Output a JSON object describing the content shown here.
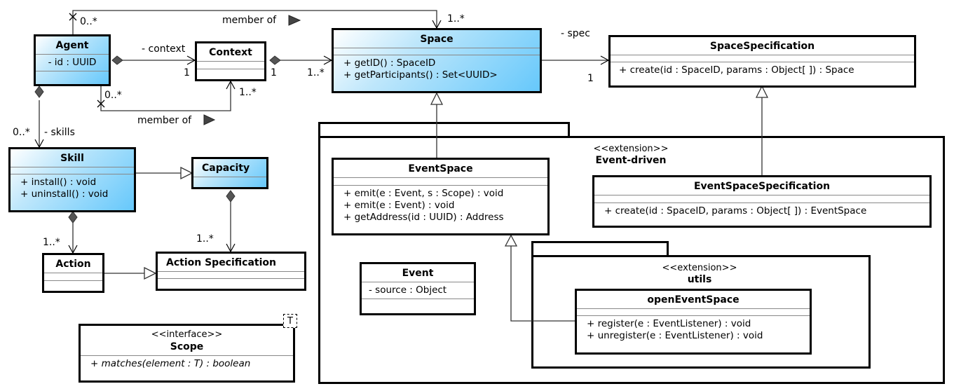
{
  "classes": {
    "agent": {
      "name": "Agent",
      "attributes": [
        "- id : UUID"
      ],
      "operations": []
    },
    "context": {
      "name": "Context",
      "attributes": [],
      "operations": []
    },
    "space": {
      "name": "Space",
      "attributes": [],
      "operations": [
        "+ getID() : SpaceID",
        "+ getParticipants() : Set<UUID>"
      ]
    },
    "space_specification": {
      "name": "SpaceSpecification",
      "attributes": [],
      "operations": [
        "+ create(id : SpaceID, params : Object[ ]) : Space"
      ]
    },
    "skill": {
      "name": "Skill",
      "attributes": [],
      "operations": [
        "+ install() : void",
        "+ uninstall() : void"
      ]
    },
    "capacity": {
      "name": "Capacity",
      "attributes": []
    },
    "action": {
      "name": "Action",
      "attributes": [],
      "operations": []
    },
    "action_specification": {
      "name": "Action Specification",
      "attributes": [],
      "operations": []
    },
    "scope": {
      "stereotype": "<<interface>>",
      "name": "Scope",
      "template_param": "T",
      "operations": [
        "+ matches(element : T) : boolean"
      ]
    },
    "event_space": {
      "name": "EventSpace",
      "attributes": [],
      "operations": [
        "+ emit(e : Event, s : Scope) : void",
        "+ emit(e : Event) : void",
        "+ getAddress(id : UUID) : Address"
      ]
    },
    "event_space_specification": {
      "name": "EventSpaceSpecification",
      "attributes": [],
      "operations": [
        "+ create(id : SpaceID, params : Object[ ]) : EventSpace"
      ]
    },
    "event": {
      "name": "Event",
      "attributes": [
        "- source : Object"
      ],
      "operations": []
    },
    "open_event_space": {
      "name": "openEventSpace",
      "attributes": [],
      "operations": [
        "+ register(e : EventListener) : void",
        "+ unregister(e : EventListener) : void"
      ]
    }
  },
  "packages": {
    "event_driven": {
      "stereotype": "<<extension>>",
      "name": "Event-driven"
    },
    "utils": {
      "stereotype": "<<extension>>",
      "name": "utils"
    }
  },
  "labels": {
    "agent_space_mult_agent": "0..*",
    "agent_space_mult_space": "1..*",
    "agent_space_member_of": "member of",
    "agent_context_role": "- context",
    "agent_context_mult_agent": "1",
    "context_space_mult_context": "1",
    "context_space_mult_space": "1..*",
    "agent_context_member_mult_agent": "0..*",
    "agent_context_member_mult_context": "1..*",
    "agent_context_member_of": "member of",
    "agent_skill_mult": "0..*",
    "agent_skill_role": "- skills",
    "space_spec_role": "- spec",
    "space_spec_mult": "1",
    "skill_action_mult": "1..*",
    "capacity_actionspec_mult": "1..*"
  },
  "colors": {
    "class_highlight": "#66c8fb",
    "border": "#000000",
    "composition_diamond": "#555555"
  }
}
